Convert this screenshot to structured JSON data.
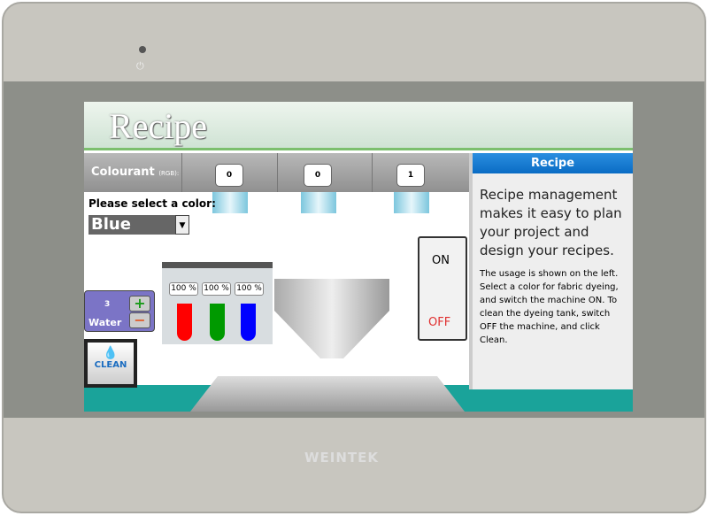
{
  "device": {
    "brand": "WEINTEK",
    "power_icon": "power-icon"
  },
  "screen": {
    "title": "Recipe",
    "colourant": {
      "label": "Colourant",
      "unit": "(RGB):",
      "values": [
        "0",
        "0",
        "1"
      ]
    },
    "prompt": "Please select a color:",
    "color_select": {
      "value": "Blue",
      "arrow": "▼"
    },
    "tubes": {
      "percents": [
        "100 %",
        "100 %",
        "100 %"
      ],
      "colors": [
        "#ff0000",
        "#009a00",
        "#0000ff"
      ]
    },
    "water": {
      "value": "3",
      "label": "Water",
      "plus": "+",
      "minus": "−"
    },
    "clean": {
      "label": "CLEAN",
      "icon": "💧"
    },
    "switch": {
      "on": "ON",
      "off": "OFF"
    },
    "panel": {
      "header": "Recipe",
      "intro": "Recipe management makes it easy to plan your project and design your recipes.",
      "usage": "The usage is shown on the left. Select a color for fabric dyeing, and switch the machine ON. To clean the dyeing tank, switch OFF the machine, and click Clean."
    }
  }
}
